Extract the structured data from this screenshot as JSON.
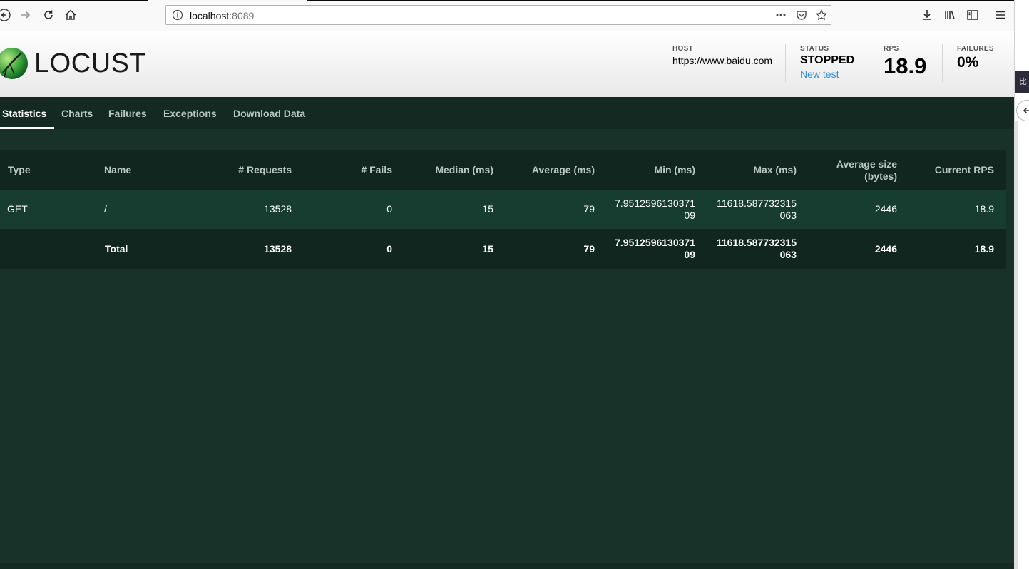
{
  "browser": {
    "url_host": "localhost",
    "url_port": ":8089"
  },
  "header": {
    "logo_text": "LOCUST",
    "host": {
      "label": "HOST",
      "value": "https://www.baidu.com"
    },
    "status": {
      "label": "STATUS",
      "value": "STOPPED",
      "link": "New test"
    },
    "rps": {
      "label": "RPS",
      "value": "18.9"
    },
    "failures": {
      "label": "FAILURES",
      "value": "0%"
    }
  },
  "tabs": [
    {
      "label": "Statistics",
      "active": true
    },
    {
      "label": "Charts"
    },
    {
      "label": "Failures"
    },
    {
      "label": "Exceptions"
    },
    {
      "label": "Download Data"
    }
  ],
  "table": {
    "columns": [
      "Type",
      "Name",
      "# Requests",
      "# Fails",
      "Median (ms)",
      "Average (ms)",
      "Min (ms)",
      "Max (ms)",
      "Average size (bytes)",
      "Current RPS"
    ],
    "rows": [
      {
        "type": "GET",
        "name": "/",
        "requests": "13528",
        "fails": "0",
        "median": "15",
        "average": "79",
        "min_a": "7.9512596130371",
        "min_b": "09",
        "max_a": "11618.587732315",
        "max_b": "063",
        "avg_size": "2446",
        "current_rps": "18.9"
      }
    ],
    "total": {
      "type": "",
      "name": "Total",
      "requests": "13528",
      "fails": "0",
      "median": "15",
      "average": "79",
      "min_a": "7.9512596130371",
      "min_b": "09",
      "max_a": "11618.587732315",
      "max_b": "063",
      "avg_size": "2446",
      "current_rps": "18.9"
    },
    "avg_size_header_a": "Average size",
    "avg_size_header_b": "(bytes)"
  },
  "edge": {
    "dark_text": "比"
  },
  "colors": {
    "app_bg": "#18322a",
    "tab_bar": "#132922",
    "row_alt": "#163d30",
    "link": "#2d8fd5"
  }
}
